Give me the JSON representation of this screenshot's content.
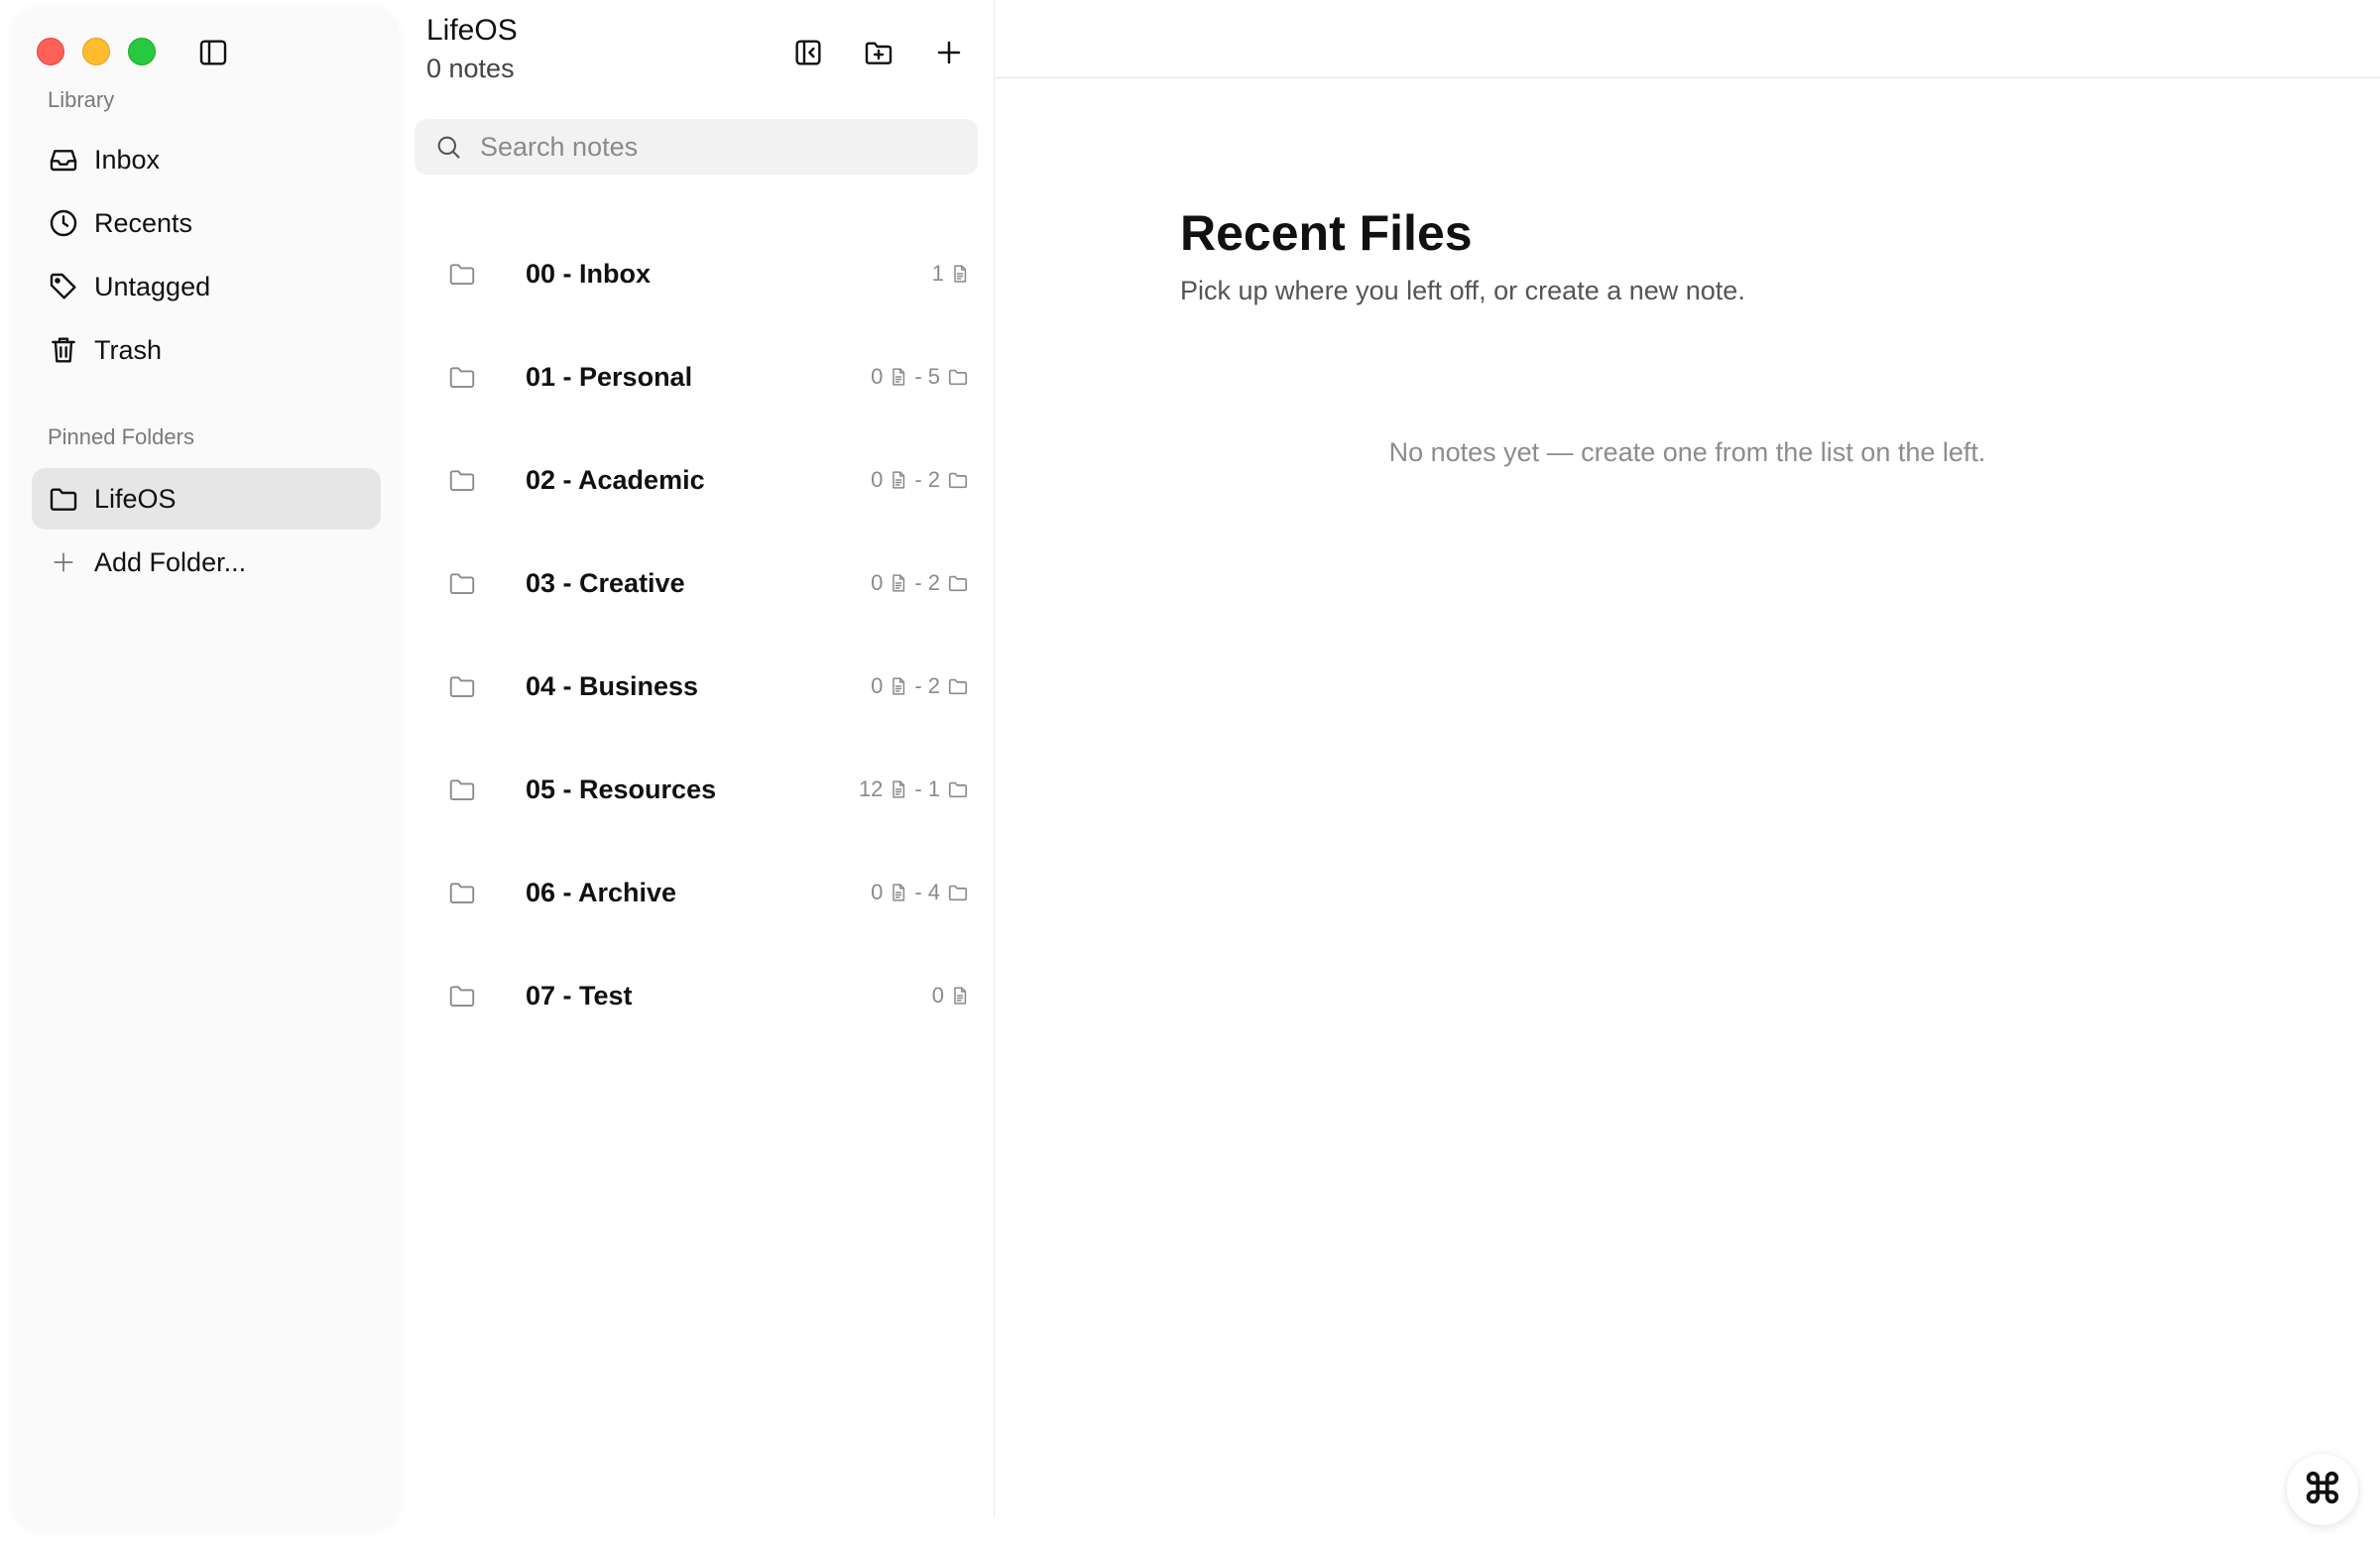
{
  "sidebar": {
    "library_label": "Library",
    "nav": [
      {
        "label": "Inbox",
        "icon": "inbox-icon"
      },
      {
        "label": "Recents",
        "icon": "clock-icon"
      },
      {
        "label": "Untagged",
        "icon": "tag-icon"
      },
      {
        "label": "Trash",
        "icon": "trash-icon"
      }
    ],
    "pinned_label": "Pinned Folders",
    "pinned": [
      {
        "label": "LifeOS",
        "icon": "folder-icon",
        "active": true
      }
    ],
    "add_folder_label": "Add Folder..."
  },
  "list": {
    "title": "LifeOS",
    "count_label": "0 notes",
    "search_placeholder": "Search notes",
    "folders": [
      {
        "name": "00 - Inbox",
        "notes": "1",
        "subfolders": null
      },
      {
        "name": "01 - Personal",
        "notes": "0",
        "subfolders": "5"
      },
      {
        "name": "02 - Academic",
        "notes": "0",
        "subfolders": "2"
      },
      {
        "name": "03 - Creative",
        "notes": "0",
        "subfolders": "2"
      },
      {
        "name": "04 - Business",
        "notes": "0",
        "subfolders": "2"
      },
      {
        "name": "05 - Resources",
        "notes": "12",
        "subfolders": "1"
      },
      {
        "name": "06 - Archive",
        "notes": "0",
        "subfolders": "4"
      },
      {
        "name": "07 - Test",
        "notes": "0",
        "subfolders": null
      }
    ],
    "separator": "-"
  },
  "main": {
    "title": "Recent Files",
    "subtitle": "Pick up where you left off, or create a new note.",
    "empty_message": "No notes yet — create one from the list on the left."
  },
  "colors": {
    "traffic_red": "#fe5f57",
    "traffic_yellow": "#febc2e",
    "traffic_green": "#28c840",
    "sidebar_bg": "#fafafa",
    "active_item_bg": "#e6e6e6"
  }
}
